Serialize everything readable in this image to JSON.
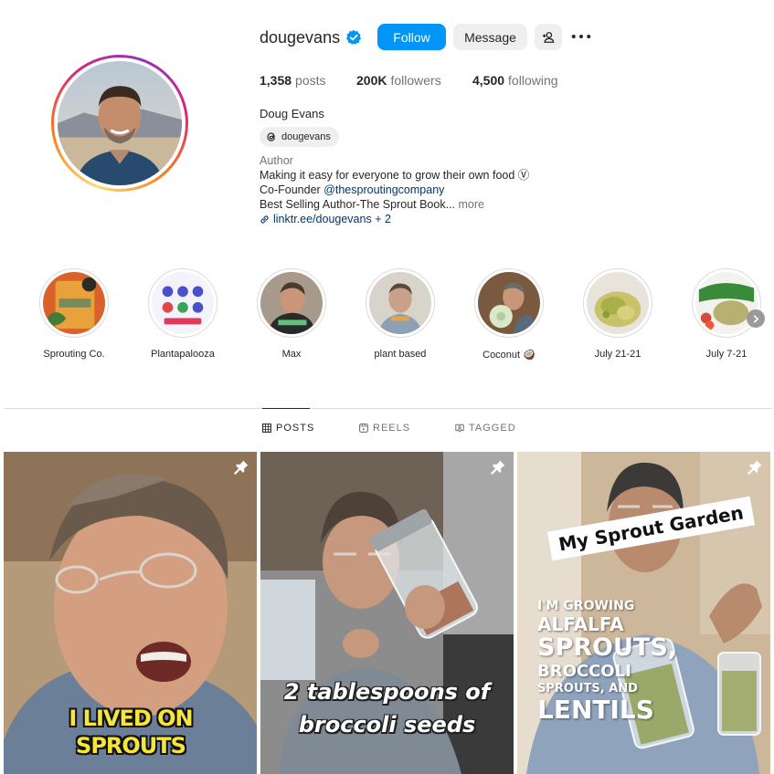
{
  "profile": {
    "username": "dougevans",
    "verified": true,
    "follow_label": "Follow",
    "message_label": "Message",
    "full_name": "Doug Evans",
    "threads_handle": "dougevans",
    "category": "Author",
    "bio_line1": "Making it easy for everyone to grow their own food Ⓥ",
    "bio_line2_prefix": "Co-Founder ",
    "bio_line2_mention": "@thesproutingcompany",
    "bio_line3": "Best Selling Author-The Sprout Book...",
    "bio_more": " more",
    "link_text": "linktr.ee/dougevans + 2"
  },
  "stats": {
    "posts_count": "1,358",
    "posts_label": "posts",
    "followers_count": "200K",
    "followers_label": "followers",
    "following_count": "4,500",
    "following_label": "following"
  },
  "highlights": [
    {
      "label": "Sprouting Co."
    },
    {
      "label": "Plantapalooza"
    },
    {
      "label": "Max"
    },
    {
      "label": "plant based"
    },
    {
      "label": "Coconut 🥥"
    },
    {
      "label": "July 21-21"
    },
    {
      "label": "July 7-21"
    }
  ],
  "tabs": {
    "posts": "POSTS",
    "reels": "REELS",
    "tagged": "TAGGED"
  },
  "posts": [
    {
      "caption_l1": "I LIVED ON",
      "caption_l2": "SPROUTS",
      "pinned": true
    },
    {
      "caption_l1": "2 tablespoons of",
      "caption_l2": "broccoli seeds",
      "pinned": true
    },
    {
      "banner": "My Sprout Garden",
      "caption_l1": "I'M GROWING",
      "caption_l2": "ALFALFA",
      "caption_l3": "SPROUTS,",
      "caption_l4": "BROCCOLI",
      "caption_l5": "SPROUTS, AND",
      "caption_l6": "LENTILS",
      "pinned": true
    }
  ],
  "icons": {
    "verified": "verified-badge-icon",
    "add_user": "add-user-icon",
    "more": "more-options-icon",
    "threads": "threads-icon",
    "link": "link-icon",
    "next": "chevron-right-icon",
    "posts_tab": "grid-icon",
    "reels_tab": "reels-icon",
    "tagged_tab": "tagged-icon",
    "pin": "pin-icon"
  },
  "colors": {
    "accent": "#0095f6",
    "text": "#262626",
    "secondary": "#737373",
    "link": "#00376b"
  }
}
